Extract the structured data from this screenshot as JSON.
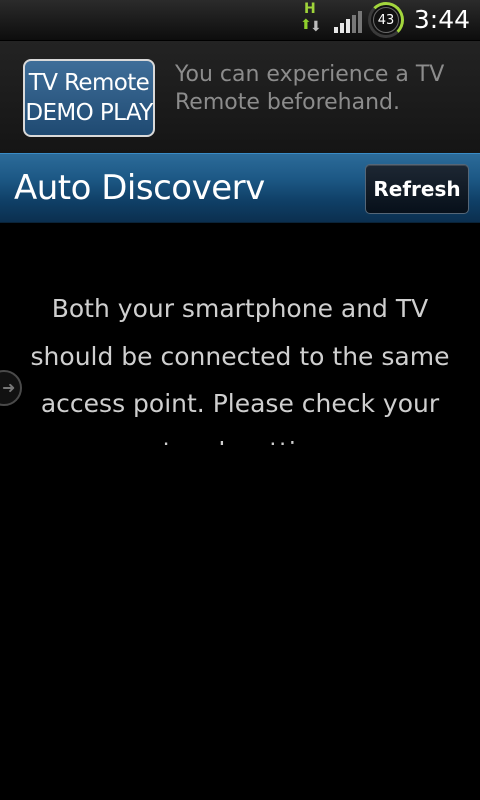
{
  "status_bar": {
    "network_type": "H",
    "battery_level": "43",
    "time": "3:44",
    "icons": [
      "hspa-icon",
      "signal-icon",
      "battery-icon"
    ]
  },
  "demo": {
    "button_line1": "TV Remote",
    "button_line2": "DEMO PLAY",
    "description": "You can experience a TV Remote beforehand."
  },
  "header": {
    "title": "Auto Discoverv",
    "refresh_label": "Refresh"
  },
  "content": {
    "message": "Both your smartphone and TV should be connected to the same access point. Please check your network settings."
  },
  "colors": {
    "accent_blue": "#1d5986",
    "battery_green": "#a3d63d",
    "background": "#000000"
  }
}
